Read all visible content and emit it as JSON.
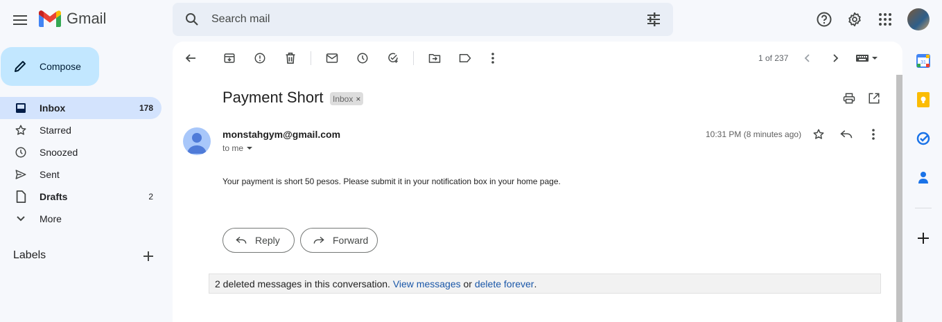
{
  "app": {
    "name": "Gmail"
  },
  "search": {
    "placeholder": "Search mail"
  },
  "compose": {
    "label": "Compose"
  },
  "sidebar": {
    "items": [
      {
        "label": "Inbox",
        "count": "178",
        "active": true
      },
      {
        "label": "Starred",
        "count": ""
      },
      {
        "label": "Snoozed",
        "count": ""
      },
      {
        "label": "Sent",
        "count": ""
      },
      {
        "label": "Drafts",
        "count": "2"
      },
      {
        "label": "More",
        "count": ""
      }
    ],
    "labels_title": "Labels"
  },
  "toolbar": {
    "pager": "1 of 237"
  },
  "message": {
    "subject": "Payment Short",
    "badge": "Inbox",
    "badge_close": "×",
    "sender": "monstahgym@gmail.com",
    "to": "to me",
    "time": "10:31 PM (8 minutes ago)",
    "body": "Your payment is short 50 pesos. Please submit it in your notification box in your home page."
  },
  "actions": {
    "reply": "Reply",
    "forward": "Forward"
  },
  "deleted_notice": {
    "text": "2 deleted messages in this conversation.",
    "view_link": "View messages",
    "or": "or",
    "delete_link": "delete forever",
    "period": "."
  },
  "right_rail": {
    "calendar_day": "31"
  },
  "colors": {
    "accent": "#0b57d0",
    "compose_bg": "#c2e7ff",
    "active_nav": "#d3e3fd"
  }
}
